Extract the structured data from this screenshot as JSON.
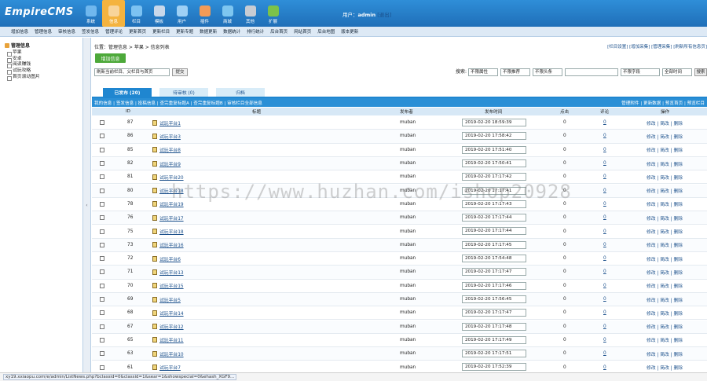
{
  "header": {
    "logo": "EmpireCMS",
    "nav": [
      {
        "label": "系统",
        "icon": "system-icon",
        "color": "#6fb7ee"
      },
      {
        "label": "信息",
        "icon": "info-icon",
        "color": "#f8d49a",
        "active": true
      },
      {
        "label": "栏目",
        "icon": "folder-icon",
        "color": "#7cc2f2"
      },
      {
        "label": "模板",
        "icon": "template-icon",
        "color": "#c9d8ea"
      },
      {
        "label": "用户",
        "icon": "user-icon",
        "color": "#9ed0f5"
      },
      {
        "label": "插件",
        "icon": "plugin-icon",
        "color": "#f29b57"
      },
      {
        "label": "商城",
        "icon": "shop-icon",
        "color": "#7ec6f0"
      },
      {
        "label": "其他",
        "icon": "gear-icon",
        "color": "#c7ccd3"
      },
      {
        "label": "扩展",
        "icon": "extend-icon",
        "color": "#7cc24a"
      }
    ],
    "user_prefix": "用户：",
    "user_name": "admin",
    "logout": "[退出]"
  },
  "submenu": [
    "增加信息",
    "管理信息",
    "审核信息",
    "签发信息",
    "管理评论",
    "更新首页",
    "更新栏目",
    "更新专题",
    "数据更新",
    "数据统计",
    "排行统计",
    "后台首页",
    "网站首页",
    "后台地图",
    "版本更新"
  ],
  "sidebar": {
    "title": "管理信息",
    "items": [
      "苹果",
      "安卓",
      "阅读赚钱",
      "试玩攻略",
      "首页滚动图片"
    ]
  },
  "main": {
    "breadcrumb": "位置：管理信息 > 苹果 > 信息列表",
    "right_links": "[栏目设置] [增加采集] [管理采集] [刷新所有信息页]",
    "add_button": "增加信息",
    "refresh_select": "刷新当前栏目、父栏目与首页",
    "submit": "提交",
    "search_label": "搜索:",
    "filter_attr": "不限属性",
    "filter_recommend": "不限推荐",
    "filter_headline": "不限头条",
    "filter_field": "不限字段",
    "filter_time": "全部时间",
    "search_button": "搜索",
    "tabs": [
      "已发布 (20)",
      "待审核 (0)",
      "归档"
    ],
    "sublinks": "我的信息 | 签发信息 | 投稿信息 | 查完重复标题A | 查完重复标题B | 审核栏目全部信息",
    "sublinks_right": "管理附件 | 更新数据 | 预览首页 | 预览栏目",
    "columns": {
      "id": "ID",
      "title": "标题",
      "publisher": "发布者",
      "time": "发布时间",
      "clicks": "点击",
      "comments": "评论",
      "ops": "操作"
    },
    "ops_text": "修改 | 简改 | 删除",
    "rows": [
      {
        "id": "87",
        "title": "试玩平台1",
        "publisher": "muban",
        "time": "2019-02-20 18:59:39",
        "clicks": "0",
        "comments": "0"
      },
      {
        "id": "86",
        "title": "试玩平台3",
        "publisher": "muban",
        "time": "2019-02-20 17:58:42",
        "clicks": "0",
        "comments": "0"
      },
      {
        "id": "85",
        "title": "试玩平台8",
        "publisher": "muban",
        "time": "2019-02-20 17:51:40",
        "clicks": "0",
        "comments": "0"
      },
      {
        "id": "82",
        "title": "试玩平台9",
        "publisher": "muban",
        "time": "2019-02-20 17:50:41",
        "clicks": "0",
        "comments": "0"
      },
      {
        "id": "81",
        "title": "试玩平台20",
        "publisher": "muban",
        "time": "2019-02-20 17:17:42",
        "clicks": "0",
        "comments": "0"
      },
      {
        "id": "80",
        "title": "试玩平台18",
        "publisher": "muban",
        "time": "2019-02-20 17:17:41",
        "clicks": "0",
        "comments": "0"
      },
      {
        "id": "78",
        "title": "试玩平台19",
        "publisher": "muban",
        "time": "2019-02-20 17:17:43",
        "clicks": "0",
        "comments": "0"
      },
      {
        "id": "76",
        "title": "试玩平台17",
        "publisher": "muban",
        "time": "2019-02-20 17:17:44",
        "clicks": "0",
        "comments": "0"
      },
      {
        "id": "75",
        "title": "试玩平台18",
        "publisher": "muban",
        "time": "2019-02-20 17:17:44",
        "clicks": "0",
        "comments": "0"
      },
      {
        "id": "73",
        "title": "试玩平台16",
        "publisher": "muban",
        "time": "2019-02-20 17:17:45",
        "clicks": "0",
        "comments": "0"
      },
      {
        "id": "72",
        "title": "试玩平台6",
        "publisher": "muban",
        "time": "2019-02-20 17:54:48",
        "clicks": "0",
        "comments": "0"
      },
      {
        "id": "71",
        "title": "试玩平台13",
        "publisher": "muban",
        "time": "2019-02-20 17:17:47",
        "clicks": "0",
        "comments": "0"
      },
      {
        "id": "70",
        "title": "试玩平台15",
        "publisher": "muban",
        "time": "2019-02-20 17:17:46",
        "clicks": "0",
        "comments": "0"
      },
      {
        "id": "69",
        "title": "试玩平台5",
        "publisher": "muban",
        "time": "2019-02-20 17:56:45",
        "clicks": "0",
        "comments": "0"
      },
      {
        "id": "68",
        "title": "试玩平台14",
        "publisher": "muban",
        "time": "2019-02-20 17:17:47",
        "clicks": "0",
        "comments": "0"
      },
      {
        "id": "67",
        "title": "试玩平台12",
        "publisher": "muban",
        "time": "2019-02-20 17:17:48",
        "clicks": "0",
        "comments": "0"
      },
      {
        "id": "65",
        "title": "试玩平台11",
        "publisher": "muban",
        "time": "2019-02-20 17:17:49",
        "clicks": "0",
        "comments": "0"
      },
      {
        "id": "63",
        "title": "试玩平台10",
        "publisher": "muban",
        "time": "2019-02-20 17:17:51",
        "clicks": "0",
        "comments": "0"
      },
      {
        "id": "61",
        "title": "试玩平台7",
        "publisher": "muban",
        "time": "2019-02-20 17:52:39",
        "clicks": "0",
        "comments": "0"
      }
    ]
  },
  "watermark": "https://www.huzhan.com/ishop20928",
  "statusbar": "xy19.xxiaopu.com/e/admin/ListNews.php?bclassid=0&classid=1&sear=1&showspecial=0&ehash_XGF9..."
}
